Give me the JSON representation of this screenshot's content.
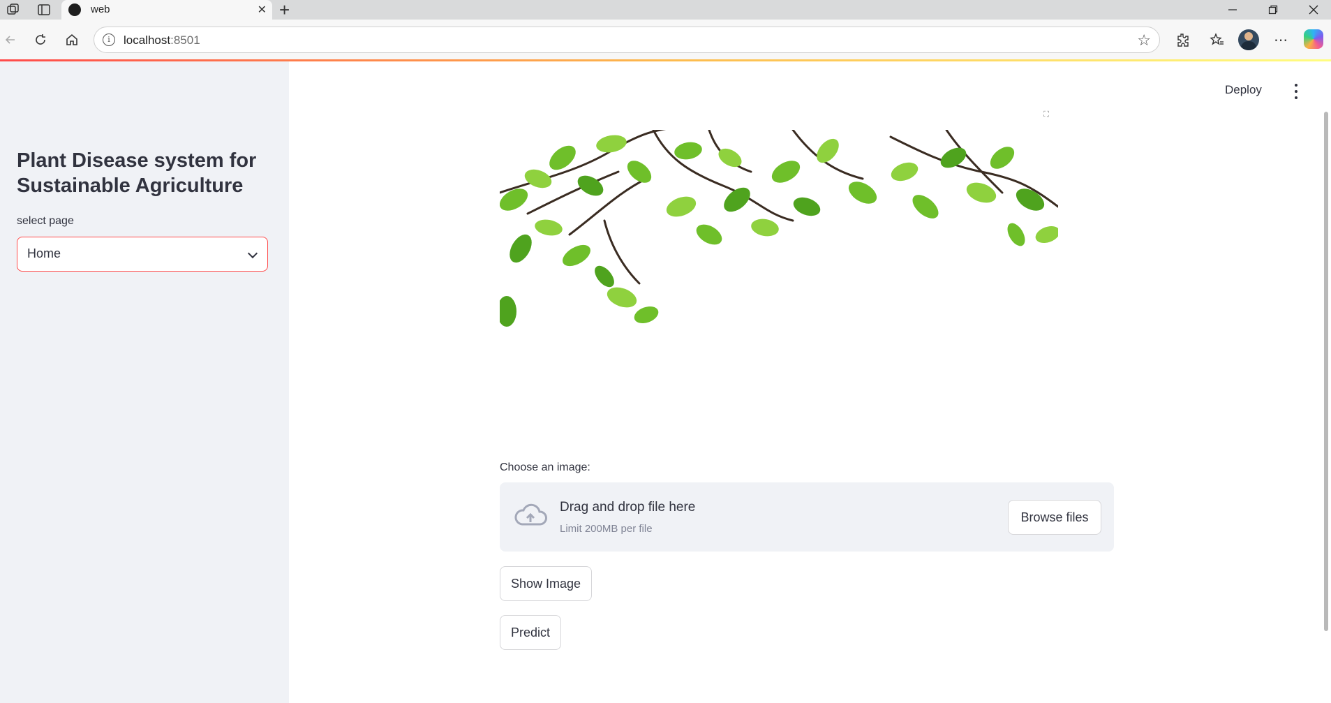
{
  "browser": {
    "tab_title": "web",
    "url_host": "localhost",
    "url_port": ":8501"
  },
  "header": {
    "deploy_label": "Deploy"
  },
  "sidebar": {
    "title": "Plant Disease system for Sustainable Agriculture",
    "select_label": "select page",
    "select_value": "Home"
  },
  "main": {
    "upload": {
      "label": "Choose an image:",
      "drop_text": "Drag and drop file here",
      "limit_text": "Limit 200MB per file",
      "browse_label": "Browse files"
    },
    "show_image_label": "Show Image",
    "predict_label": "Predict"
  },
  "colors": {
    "accent": "#ff4b4b",
    "sidebar_bg": "#f0f2f6",
    "text": "#31333f",
    "leaf_green": "#6fbf2a"
  }
}
